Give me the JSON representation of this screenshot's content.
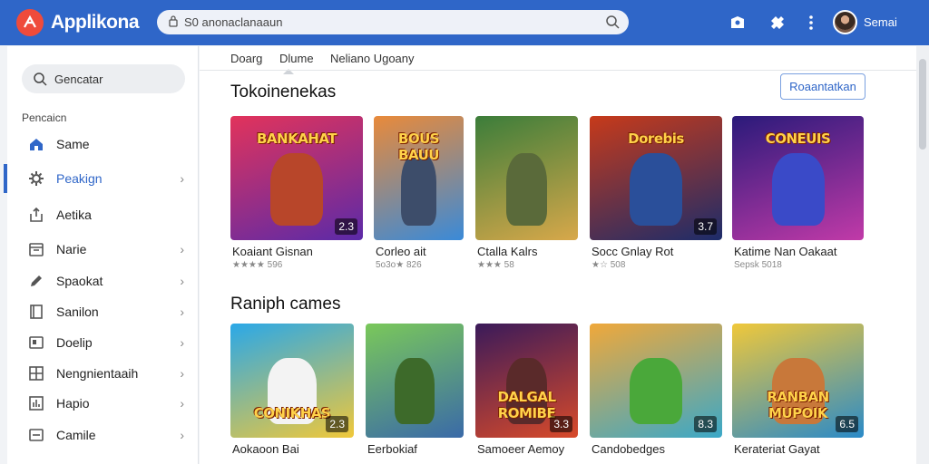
{
  "app": {
    "title": "Applikona"
  },
  "search": {
    "text": "S0 anonaclanaaun"
  },
  "user": {
    "name": "Semai"
  },
  "sidebar": {
    "search_label": "Gencatar",
    "header": "Pencaicn",
    "items": [
      {
        "label": "Same",
        "icon": "home-icon",
        "chevron": false,
        "active": false
      },
      {
        "label": "Peakign",
        "icon": "gear-icon",
        "chevron": true,
        "active": true
      },
      {
        "label": "Aetika",
        "icon": "upload-icon",
        "chevron": false,
        "active": false
      },
      {
        "label": "Narie",
        "icon": "calendar-icon",
        "chevron": true,
        "active": false
      },
      {
        "label": "Spaokat",
        "icon": "pencil-icon",
        "chevron": true,
        "active": false
      },
      {
        "label": "Sanilon",
        "icon": "document-icon",
        "chevron": true,
        "active": false
      },
      {
        "label": "Doelip",
        "icon": "image-icon",
        "chevron": true,
        "active": false
      },
      {
        "label": "Nengnientaaih",
        "icon": "grid-icon",
        "chevron": true,
        "active": false
      },
      {
        "label": "Hapio",
        "icon": "chart-icon",
        "chevron": true,
        "active": false
      },
      {
        "label": "Camile",
        "icon": "window-icon",
        "chevron": true,
        "active": false
      }
    ]
  },
  "tabs": [
    {
      "label": "Doarg",
      "active": false
    },
    {
      "label": "Dlume",
      "active": true
    },
    {
      "label": "Neliano Ugoany",
      "active": false
    }
  ],
  "section1": {
    "title": "Tokoinenekas",
    "button": "Roaantatkan",
    "games": [
      {
        "banner": "BANKAHAT",
        "title": "Koaiant Gisnan",
        "meta": "★★★★ 596",
        "rating": "2.3",
        "colors": [
          "#e2335b",
          "#5b2aa8"
        ],
        "hero": "#b8462a"
      },
      {
        "banner": "BOUS BAUU",
        "title": "Corleo ait",
        "meta": "5o3o★ 826",
        "rating": "",
        "colors": [
          "#e98a3a",
          "#3a8ad8"
        ],
        "hero": "#3d4d6a"
      },
      {
        "banner": "",
        "title": "Ctalla Kalrs",
        "meta": "★★★ 58",
        "rating": "",
        "colors": [
          "#3b7d3a",
          "#d8a84a"
        ],
        "hero": "#5a6a3a"
      },
      {
        "banner": "Dorebis",
        "title": "Socc Gnlay Rot",
        "meta": "★☆ 508",
        "rating": "3.7",
        "colors": [
          "#c73a1a",
          "#1c2c6a"
        ],
        "hero": "#2a4f9a"
      },
      {
        "banner": "CONEUIS",
        "title": "Katime Nan Oakaat",
        "meta": "Sepsk 5018",
        "rating": "",
        "colors": [
          "#2a1a7a",
          "#c13aa8"
        ],
        "hero": "#3a4ac8"
      }
    ]
  },
  "section2": {
    "title": "Raniph cames",
    "games": [
      {
        "banner": "CONIKHAS",
        "title": "Aokaoon Bai",
        "meta": "",
        "rating": "2.3",
        "colors": [
          "#2aa8e8",
          "#f0c83a"
        ],
        "hero": "#f3f3f3"
      },
      {
        "banner": "",
        "title": "Eerbokiaf",
        "meta": "",
        "rating": "",
        "colors": [
          "#7ac85a",
          "#3a6aa8"
        ],
        "hero": "#3d6a2a"
      },
      {
        "banner": "DALGAL ROMIBE",
        "title": "Samoeer Aemoy",
        "meta": "",
        "rating": "3.3",
        "colors": [
          "#3a1a5a",
          "#d84a2a"
        ],
        "hero": "#5a2a2a"
      },
      {
        "banner": "",
        "title": "Candobedges",
        "meta": "",
        "rating": "8.3",
        "colors": [
          "#f0a83a",
          "#3aa8c8"
        ],
        "hero": "#4aa83a"
      },
      {
        "banner": "RANBAN MUPOIK",
        "title": "Kerateriat Gayat",
        "meta": "",
        "rating": "6.5",
        "colors": [
          "#f0c83a",
          "#2a8ac8"
        ],
        "hero": "#c8783a"
      }
    ]
  }
}
